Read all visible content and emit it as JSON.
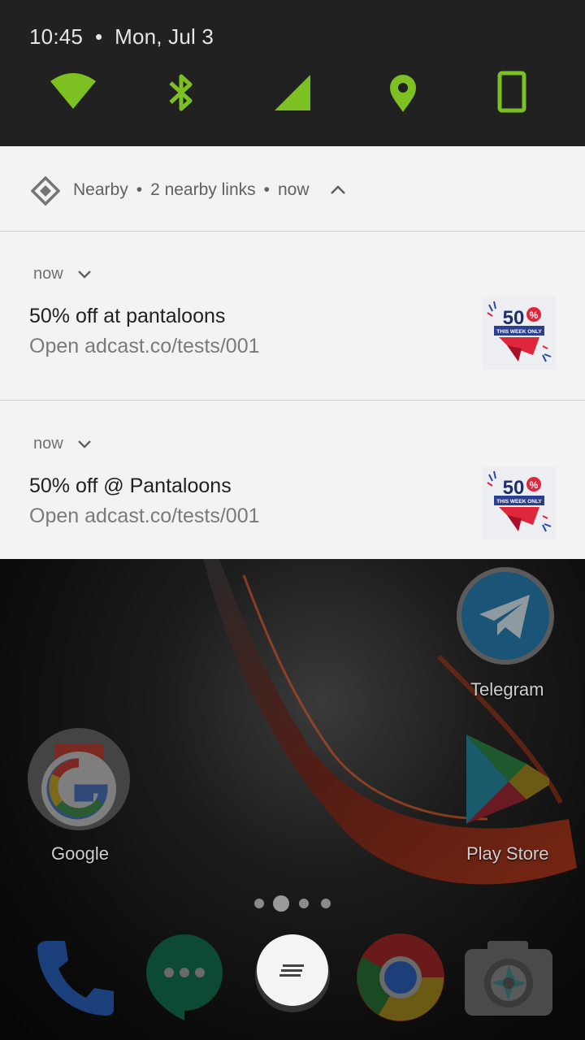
{
  "status": {
    "time": "10:45",
    "date": "Mon, Jul 3",
    "accent_color": "#7cc022",
    "tiles": [
      "wifi-icon",
      "bluetooth-icon",
      "cell-signal-icon",
      "location-icon",
      "rotation-portrait-icon"
    ]
  },
  "nearby": {
    "app": "Nearby",
    "summary": "2 nearby links",
    "time": "now"
  },
  "notifications": [
    {
      "time": "now",
      "title": "50% off at pantaloons",
      "body": "Open adcast.co/tests/001",
      "badge_big": "50",
      "badge_pct": "%",
      "badge_sub": "THIS WEEK ONLY"
    },
    {
      "time": "now",
      "title": "50% off @ Pantaloons",
      "body": "Open adcast.co/tests/001",
      "badge_big": "50",
      "badge_pct": "%",
      "badge_sub": "THIS WEEK ONLY"
    }
  ],
  "home": {
    "apps": [
      {
        "label": "Telegram",
        "icon": "telegram-icon"
      },
      {
        "label": "Google",
        "icon": "google-icon"
      },
      {
        "label": "Play Store",
        "icon": "play-store-icon"
      }
    ],
    "page_indicator": {
      "pages": 4,
      "current": 2
    },
    "dock": [
      "phone-icon",
      "hangouts-icon",
      "app-drawer-icon",
      "chrome-icon",
      "camera-icon"
    ]
  }
}
